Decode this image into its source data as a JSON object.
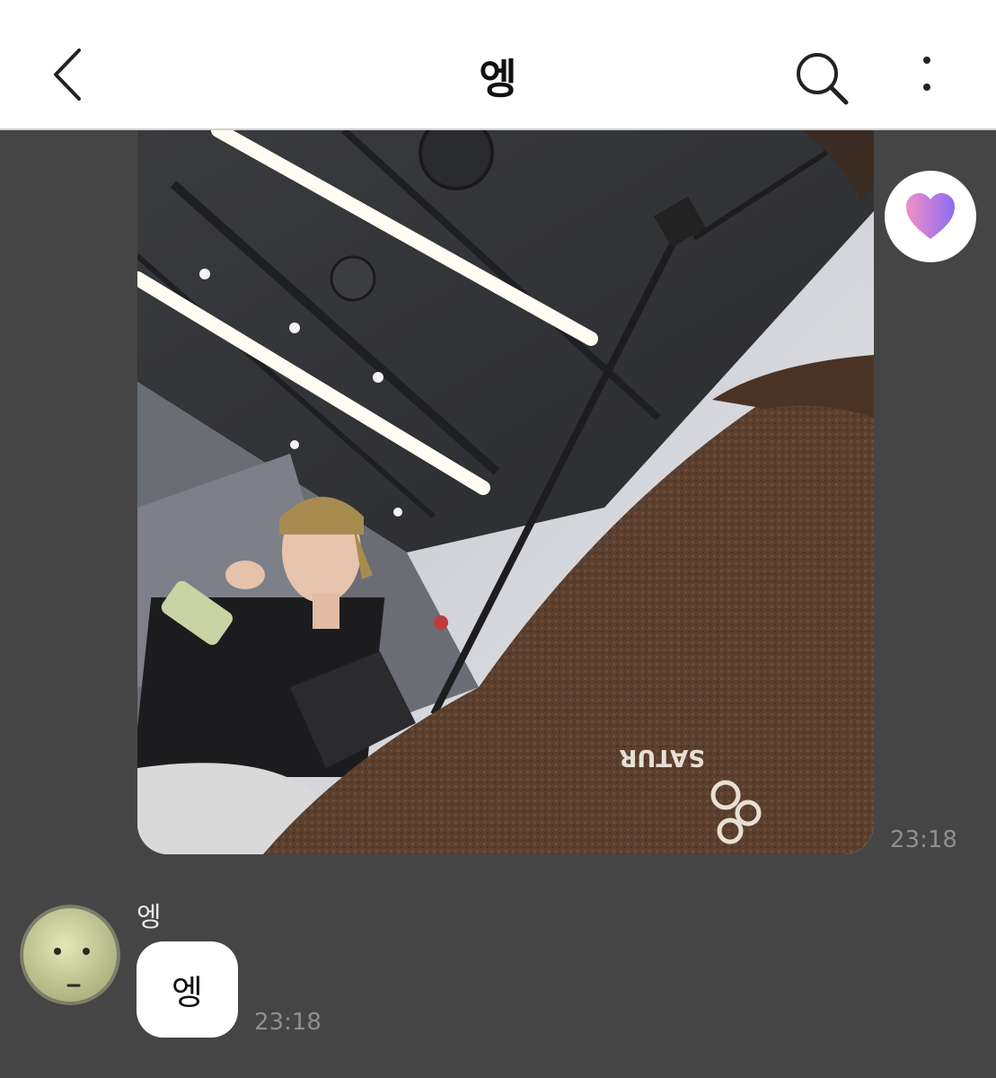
{
  "header": {
    "title": "엥",
    "back_icon": "chevron-left-icon",
    "search_icon": "search-icon",
    "more_icon": "more-vertical-icon"
  },
  "messages": [
    {
      "type": "photo",
      "time": "23:18",
      "reaction_icon": "heart-reaction-icon",
      "image_logo_text": "SATUR"
    },
    {
      "type": "text",
      "sender": "엥",
      "text": "엥",
      "time": "23:18",
      "avatar_icon": "avatar-face-icon"
    }
  ],
  "colors": {
    "background": "#454545",
    "header_bg": "#ffffff",
    "bubble_bg": "#ffffff",
    "time_text": "#8f8f8f",
    "heart_gradient_start": "#f28fc4",
    "heart_gradient_end": "#8a6cf2"
  }
}
